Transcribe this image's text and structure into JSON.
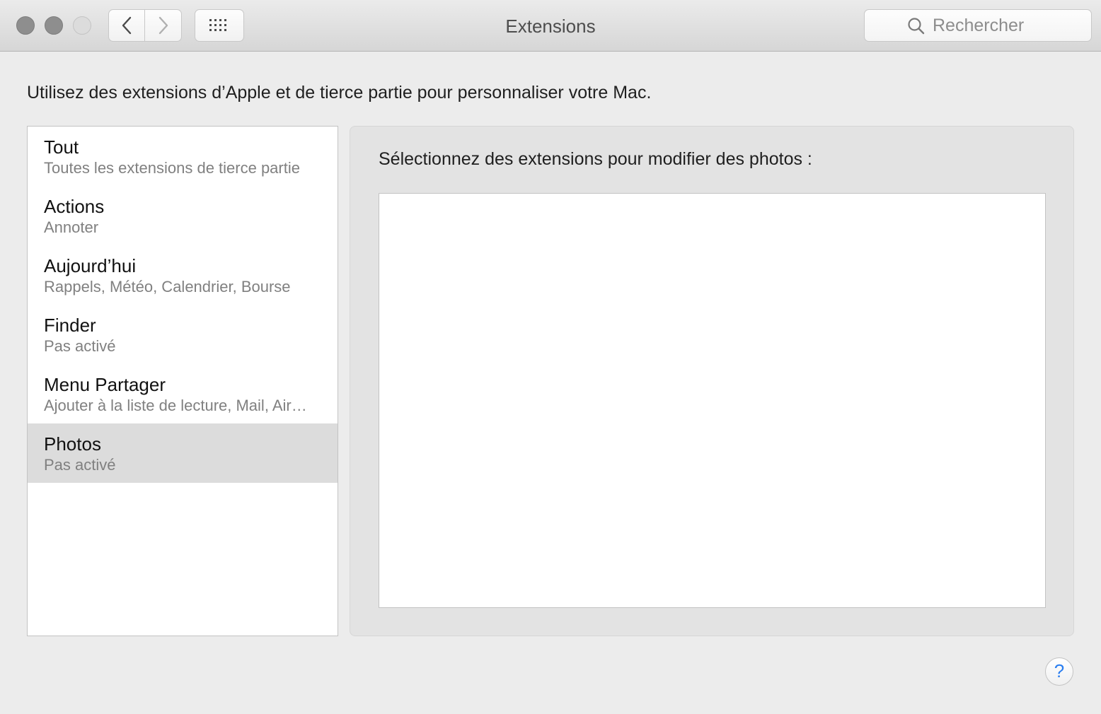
{
  "window": {
    "title": "Extensions"
  },
  "toolbar": {
    "search_placeholder": "Rechercher"
  },
  "intro_text": "Utilisez des extensions d’Apple et de tierce partie pour personnaliser votre Mac.",
  "sidebar": {
    "items": [
      {
        "title": "Tout",
        "subtitle": "Toutes les extensions de tierce partie",
        "selected": false
      },
      {
        "title": "Actions",
        "subtitle": "Annoter",
        "selected": false
      },
      {
        "title": "Aujourd’hui",
        "subtitle": "Rappels, Météo, Calendrier, Bourse",
        "selected": false
      },
      {
        "title": "Finder",
        "subtitle": "Pas activé",
        "selected": false
      },
      {
        "title": "Menu Partager",
        "subtitle": "Ajouter à la liste de lecture, Mail, Air…",
        "selected": false
      },
      {
        "title": "Photos",
        "subtitle": "Pas activé",
        "selected": true
      }
    ]
  },
  "panel": {
    "label": "Sélectionnez des extensions pour modifier des photos :"
  },
  "help": {
    "label": "?"
  },
  "colors": {
    "help_accent": "#2a7ef0",
    "selected_row": "#dcdcdc"
  }
}
